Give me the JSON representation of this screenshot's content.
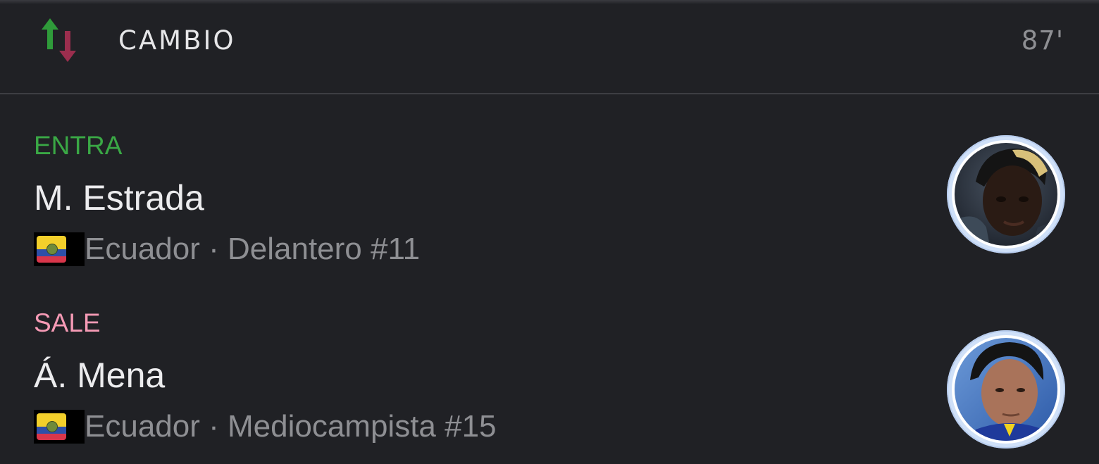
{
  "header": {
    "icon": "substitution-arrows-icon",
    "title": "CAMBIO",
    "minute": "87'"
  },
  "colors": {
    "background": "#202125",
    "in_accent": "#3aa845",
    "out_accent": "#f59ab5",
    "arrow_up": "#2f9b3a",
    "arrow_down": "#9b2e4e"
  },
  "player_in": {
    "role": "ENTRA",
    "name": "M. Estrada",
    "meta": "Ecuador · Delantero #11",
    "flag": "ecuador-flag-icon"
  },
  "player_out": {
    "role": "SALE",
    "name": "Á. Mena",
    "meta": "Ecuador · Mediocampista #15",
    "flag": "ecuador-flag-icon"
  }
}
